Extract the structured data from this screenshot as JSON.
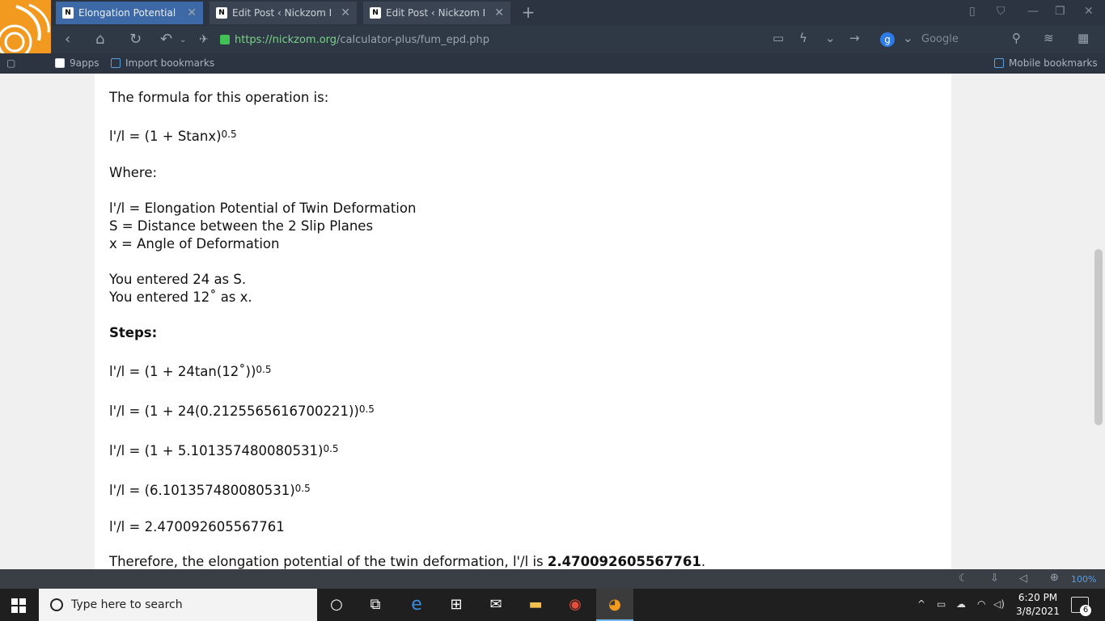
{
  "browser": {
    "tabs": [
      {
        "label": "Elongation Potential of",
        "favicon": "N",
        "active": true
      },
      {
        "label": "Edit Post ‹ Nickzom Blo",
        "favicon": "N",
        "active": false
      },
      {
        "label": "Edit Post ‹ Nickzom Blo",
        "favicon": "N",
        "active": false
      }
    ],
    "url_host": "https://nickzom.org",
    "url_path": "/calculator-plus/fum_epd.php",
    "search_engine_badge": "g",
    "search_engine_label": "Google",
    "bookmarks": [
      {
        "label": "9apps"
      },
      {
        "label": "Import bookmarks"
      }
    ],
    "mobile_bookmarks": "Mobile bookmarks",
    "zoom": "100%"
  },
  "page": {
    "formula_intro": "The formula for this operation is:",
    "formula": "l'/l = (1 + Stanx)",
    "exp": "0.5",
    "where": "Where:",
    "def1": "l'/l = Elongation Potential of Twin Deformation",
    "def2": "S = Distance between the 2 Slip Planes",
    "def3": "x = Angle of Deformation",
    "entered1": "You entered 24 as S.",
    "entered2": "You entered 12˚ as x.",
    "steps": "Steps:",
    "step1": "l'/l = (1 + 24tan(12˚))",
    "step2": "l'/l = (1 + 24(0.2125565616700221))",
    "step3": "l'/l = (1 + 5.101357480080531)",
    "step4": "l'/l = (6.101357480080531)",
    "step5": "l'/l = 2.470092605567761",
    "therefore": "Therefore, the elongation potential of the twin deformation, l'/l is ",
    "result": "2.470092605567761",
    "period": "."
  },
  "taskbar": {
    "search_placeholder": "Type here to search",
    "time": "6:20 PM",
    "date": "3/8/2021",
    "notifications": "6"
  }
}
